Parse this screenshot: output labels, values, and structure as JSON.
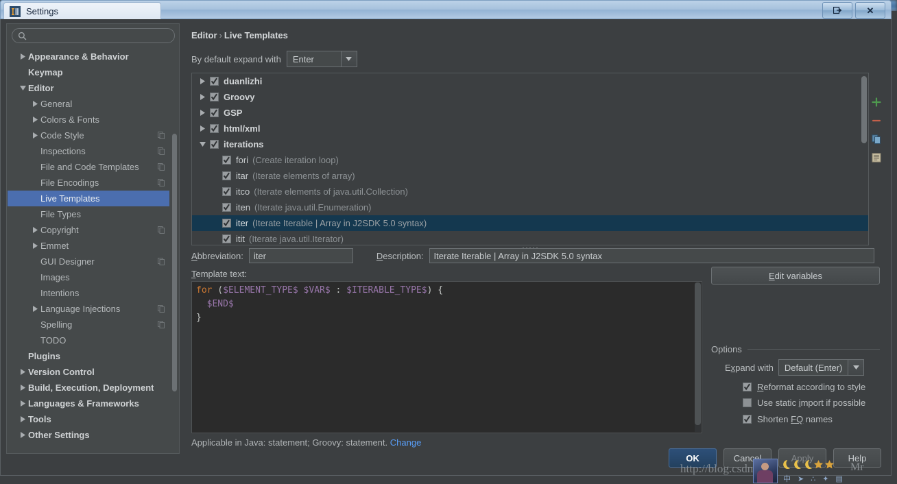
{
  "window": {
    "title": "Settings",
    "logo_icon": "intellij-logo-icon",
    "restore_label": "restore-icon",
    "close_label": "✕"
  },
  "sidebar": {
    "search": {
      "value": "",
      "placeholder": "",
      "icon": "search-icon"
    },
    "items": [
      {
        "label": "Appearance & Behavior",
        "level": 0,
        "arrow": "right",
        "bold": true,
        "copy": false
      },
      {
        "label": "Keymap",
        "level": 0,
        "arrow": "none",
        "bold": true,
        "copy": false
      },
      {
        "label": "Editor",
        "level": 0,
        "arrow": "down",
        "bold": true,
        "copy": false
      },
      {
        "label": "General",
        "level": 1,
        "arrow": "right",
        "bold": false,
        "copy": false
      },
      {
        "label": "Colors & Fonts",
        "level": 1,
        "arrow": "right",
        "bold": false,
        "copy": false
      },
      {
        "label": "Code Style",
        "level": 1,
        "arrow": "right",
        "bold": false,
        "copy": true
      },
      {
        "label": "Inspections",
        "level": 1,
        "arrow": "none",
        "bold": false,
        "copy": true
      },
      {
        "label": "File and Code Templates",
        "level": 1,
        "arrow": "none",
        "bold": false,
        "copy": true
      },
      {
        "label": "File Encodings",
        "level": 1,
        "arrow": "none",
        "bold": false,
        "copy": true
      },
      {
        "label": "Live Templates",
        "level": 1,
        "arrow": "none",
        "bold": false,
        "copy": false,
        "selected": true
      },
      {
        "label": "File Types",
        "level": 1,
        "arrow": "none",
        "bold": false,
        "copy": false
      },
      {
        "label": "Copyright",
        "level": 1,
        "arrow": "right",
        "bold": false,
        "copy": true
      },
      {
        "label": "Emmet",
        "level": 1,
        "arrow": "right",
        "bold": false,
        "copy": false
      },
      {
        "label": "GUI Designer",
        "level": 1,
        "arrow": "none",
        "bold": false,
        "copy": true
      },
      {
        "label": "Images",
        "level": 1,
        "arrow": "none",
        "bold": false,
        "copy": false
      },
      {
        "label": "Intentions",
        "level": 1,
        "arrow": "none",
        "bold": false,
        "copy": false
      },
      {
        "label": "Language Injections",
        "level": 1,
        "arrow": "right",
        "bold": false,
        "copy": true
      },
      {
        "label": "Spelling",
        "level": 1,
        "arrow": "none",
        "bold": false,
        "copy": true
      },
      {
        "label": "TODO",
        "level": 1,
        "arrow": "none",
        "bold": false,
        "copy": false
      },
      {
        "label": "Plugins",
        "level": 0,
        "arrow": "none",
        "bold": true,
        "copy": false
      },
      {
        "label": "Version Control",
        "level": 0,
        "arrow": "right",
        "bold": true,
        "copy": false
      },
      {
        "label": "Build, Execution, Deployment",
        "level": 0,
        "arrow": "right",
        "bold": true,
        "copy": false
      },
      {
        "label": "Languages & Frameworks",
        "level": 0,
        "arrow": "right",
        "bold": true,
        "copy": false
      },
      {
        "label": "Tools",
        "level": 0,
        "arrow": "right",
        "bold": true,
        "copy": false
      },
      {
        "label": "Other Settings",
        "level": 0,
        "arrow": "right",
        "bold": true,
        "copy": false
      }
    ]
  },
  "main": {
    "breadcrumb": {
      "parent": "Editor",
      "separator": "›",
      "current": "Live Templates"
    },
    "expand_row": {
      "label": "By default expand with",
      "value": "Enter"
    },
    "tree_toolbar": [
      {
        "icon": "add-icon",
        "name": "add-template-button"
      },
      {
        "icon": "remove-icon",
        "name": "remove-template-button"
      },
      {
        "icon": "copy-icon",
        "name": "duplicate-template-button"
      },
      {
        "icon": "document-icon",
        "name": "restore-defaults-button"
      }
    ],
    "templates": [
      {
        "type": "group",
        "label": "duanlizhi",
        "expanded": false,
        "checked": true
      },
      {
        "type": "group",
        "label": "Groovy",
        "expanded": false,
        "checked": true
      },
      {
        "type": "group",
        "label": "GSP",
        "expanded": false,
        "checked": true
      },
      {
        "type": "group",
        "label": "html/xml",
        "expanded": false,
        "checked": true
      },
      {
        "type": "group",
        "label": "iterations",
        "expanded": true,
        "checked": true
      },
      {
        "type": "leaf",
        "abbr": "fori",
        "desc": "(Create iteration loop)",
        "checked": true
      },
      {
        "type": "leaf",
        "abbr": "itar",
        "desc": "(Iterate elements of array)",
        "checked": true
      },
      {
        "type": "leaf",
        "abbr": "itco",
        "desc": "(Iterate elements of java.util.Collection)",
        "checked": true
      },
      {
        "type": "leaf",
        "abbr": "iten",
        "desc": "(Iterate java.util.Enumeration)",
        "checked": true
      },
      {
        "type": "leaf",
        "abbr": "iter",
        "desc": "(Iterate Iterable | Array in J2SDK 5.0 syntax)",
        "checked": true,
        "selected": true
      },
      {
        "type": "leaf",
        "abbr": "itit",
        "desc": "(Iterate java.util.Iterator)",
        "checked": true
      }
    ],
    "fields": {
      "abbreviation_label": "Abbreviation:",
      "abbreviation_mnemonic": "A",
      "abbreviation_value": "iter",
      "description_label": "Description:",
      "description_mnemonic": "D",
      "description_value": "Iterate Iterable | Array in J2SDK 5.0 syntax",
      "template_text_label": "Template text:",
      "template_text_mnemonic": "T"
    },
    "code": {
      "line1_keyword": "for",
      "line1_rest_a": " (",
      "line1_var1": "$ELEMENT_TYPE$",
      "line1_mid1": " ",
      "line1_var2": "$VAR$",
      "line1_mid2": " : ",
      "line1_var3": "$ITERABLE_TYPE$",
      "line1_rest_b": ") {",
      "line2_var": "  $END$",
      "line3": "}"
    },
    "edit_variables_button": "Edit variables",
    "edit_variables_mnemonic": "E",
    "options": {
      "legend": "Options",
      "expand_with_label": "Expand with",
      "expand_with_mnemonic": "x",
      "expand_with_value": "Default (Enter)",
      "checkboxes": [
        {
          "label": "Reformat according to style",
          "mnemonic": "R",
          "checked": true
        },
        {
          "label": "Use static import if possible",
          "mnemonic": "i",
          "checked": false
        },
        {
          "label": "Shorten FQ names",
          "mnemonic": "FQ",
          "checked": true
        }
      ]
    },
    "applicable": {
      "text": "Applicable in Java: statement; Groovy: statement.",
      "link": "Change"
    }
  },
  "buttons": {
    "ok": "OK",
    "cancel": "Cancel",
    "apply": "Apply",
    "help": "Help"
  },
  "watermark": {
    "url": "http://blog.csdn.net",
    "name": "Mr",
    "avatar": "user-avatar",
    "stars": "⭐⭐"
  },
  "colors": {
    "accent_selection": "#4b6eaf",
    "tree_selection": "#14384f",
    "background": "#3c3f41",
    "editor_background": "#2b2b2b",
    "keyword": "#cc7832",
    "variable": "#9876aa",
    "link": "#589df6",
    "add_icon": "#4e9a4e",
    "remove_icon": "#c4604a"
  }
}
